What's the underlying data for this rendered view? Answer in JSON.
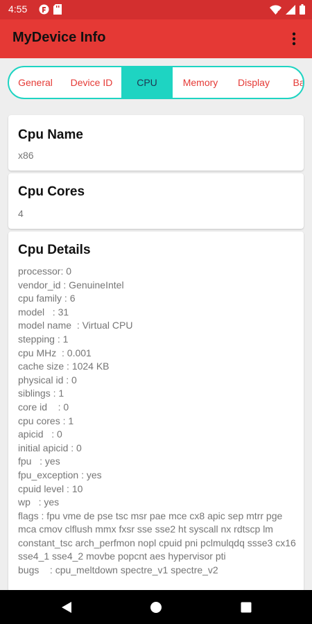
{
  "status_bar": {
    "time": "4:55",
    "left_icons": [
      "notification-icon",
      "sd-card-icon"
    ],
    "right_icons": [
      "wifi-icon",
      "signal-icon",
      "battery-icon"
    ]
  },
  "app_bar": {
    "title": "MyDevice Info",
    "overflow_icon": "more-vert-icon"
  },
  "tabs": [
    {
      "label": "General",
      "active": false
    },
    {
      "label": "Device ID",
      "active": false
    },
    {
      "label": "CPU",
      "active": true
    },
    {
      "label": "Memory",
      "active": false
    },
    {
      "label": "Display",
      "active": false
    },
    {
      "label": "Bat",
      "active": false
    }
  ],
  "cards": {
    "cpu_name": {
      "title": "Cpu Name",
      "value": "x86"
    },
    "cpu_cores": {
      "title": "Cpu Cores",
      "value": "4"
    },
    "cpu_details": {
      "title": "Cpu Details",
      "lines": [
        "processor: 0",
        "vendor_id : GenuineIntel",
        "cpu family : 6",
        "model   : 31",
        "model name  : Virtual CPU",
        "stepping : 1",
        "cpu MHz  : 0.001",
        "cache size : 1024 KB",
        "physical id : 0",
        "siblings : 1",
        "core id    : 0",
        "cpu cores : 1",
        "apicid   : 0",
        "initial apicid : 0",
        "fpu   : yes",
        "fpu_exception : yes",
        "cpuid level : 10",
        "wp   : yes"
      ],
      "flags": "flags    : fpu vme de pse tsc msr pae mce cx8 apic sep mtrr pge mca cmov clflush mmx fxsr sse sse2 ht syscall nx rdtscp lm constant_tsc arch_perfmon nopl cpuid pni pclmulqdq ssse3 cx16 sse4_1 sse4_2 movbe popcnt aes hypervisor pti",
      "bugs_partial": "bugs    : cpu_meltdown spectre_v1 spectre_v2"
    }
  },
  "nav_bar": {
    "back_icon": "back-triangle-icon",
    "home_icon": "home-circle-icon",
    "recents_icon": "recents-square-icon"
  },
  "colors": {
    "status_bar": "#d32f2f",
    "app_bar": "#e53935",
    "accent": "#1ed4c2",
    "tab_text": "#e53935",
    "active_tab_text": "#1f3550",
    "background": "#eeeeee"
  }
}
